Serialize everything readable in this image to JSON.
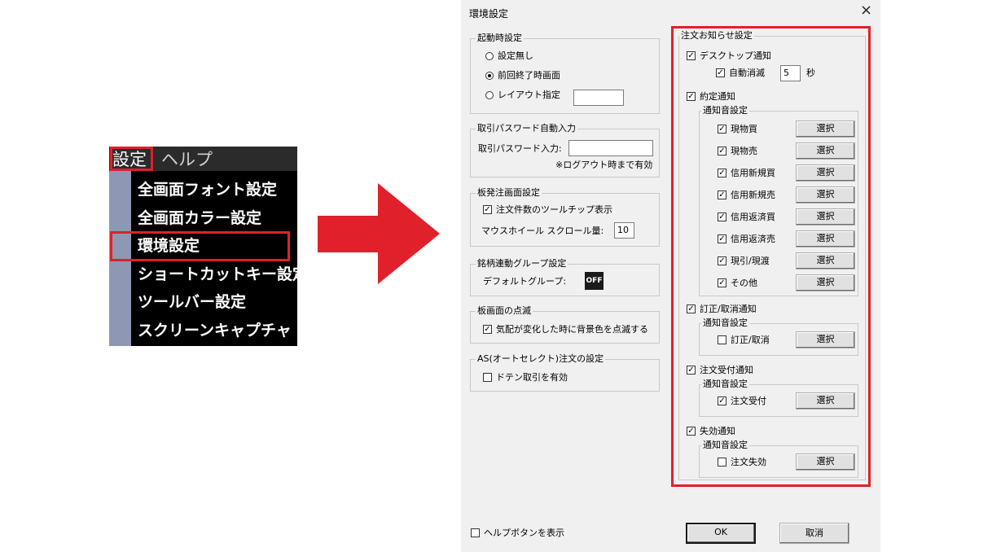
{
  "colors": {
    "highlight": "#e0202a",
    "menu_bg": "#000000",
    "menu_strip": "#8e98b4",
    "dialog_bg": "#f0f0f0"
  },
  "menu": {
    "bar": {
      "settings": "設定",
      "help": "ヘルプ"
    },
    "items": [
      "全画面フォント設定",
      "全画面カラー設定",
      "環境設定",
      "ショートカットキー設定",
      "ツールバー設定",
      "スクリーンキャプチャ"
    ]
  },
  "dialog": {
    "title": "環境設定",
    "close_icon": "×",
    "startup": {
      "title": "起動時設定",
      "options": [
        "設定無し",
        "前回終了時画面",
        "レイアウト指定"
      ],
      "selected": "前回終了時画面",
      "layout_value": ""
    },
    "password": {
      "title": "取引パスワード自動入力",
      "label": "取引パスワード入力:",
      "value": "",
      "note": "※ログアウト時まで有効"
    },
    "board_order": {
      "title": "板発注画面設定",
      "tooltip_label": "注文件数のツールチップ表示",
      "tooltip_checked": true,
      "scroll_label": "マウスホイール スクロール量:",
      "scroll_value": "10"
    },
    "link_group": {
      "title": "銘柄連動グループ設定",
      "default_label": "デフォルトグループ:",
      "default_value": "OFF"
    },
    "blink": {
      "title": "板画面の点滅",
      "label": "気配が変化した時に背景色を点滅する",
      "checked": true
    },
    "as_order": {
      "title": "AS(オートセレクト)注文の設定",
      "label": "ドテン取引を有効",
      "checked": false
    },
    "help_button_label": "ヘルプボタンを表示",
    "ok": "OK",
    "cancel": "取消",
    "notice": {
      "title": "注文お知らせ設定",
      "desktop": {
        "label": "デスクトップ通知",
        "checked": true,
        "auto_hide_label": "自動消滅",
        "auto_hide_checked": true,
        "seconds": "5",
        "seconds_unit": "秒"
      },
      "sound_title": "通知音設定",
      "select_label": "選択",
      "execution": {
        "label": "約定通知",
        "checked": true,
        "items": [
          {
            "label": "現物買",
            "checked": true
          },
          {
            "label": "現物売",
            "checked": true
          },
          {
            "label": "信用新規買",
            "checked": true
          },
          {
            "label": "信用新規売",
            "checked": true
          },
          {
            "label": "信用返済買",
            "checked": true
          },
          {
            "label": "信用返済売",
            "checked": true
          },
          {
            "label": "現引/現渡",
            "checked": true
          },
          {
            "label": "その他",
            "checked": true
          }
        ]
      },
      "correction": {
        "label": "訂正/取消通知",
        "checked": true,
        "item": {
          "label": "訂正/取消",
          "checked": false
        }
      },
      "accepted": {
        "label": "注文受付通知",
        "checked": true,
        "item": {
          "label": "注文受付",
          "checked": true
        }
      },
      "expired": {
        "label": "失効通知",
        "checked": true,
        "item": {
          "label": "注文失効",
          "checked": false
        }
      }
    }
  }
}
